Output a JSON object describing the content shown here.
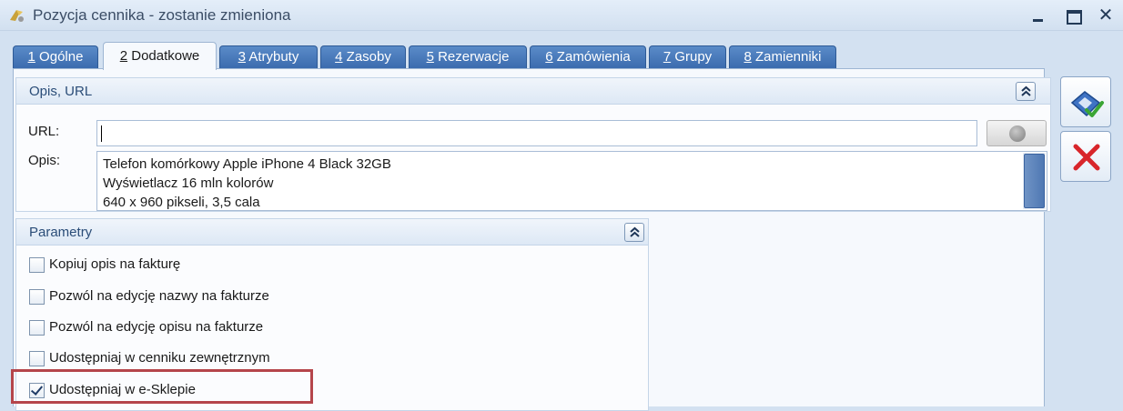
{
  "window": {
    "title": "Pozycja cennika - zostanie zmieniona",
    "close_glyph": "✕"
  },
  "tabs": [
    {
      "num": "1",
      "label": " Ogólne"
    },
    {
      "num": "2",
      "label": " Dodatkowe",
      "active": true
    },
    {
      "num": "3",
      "label": " Atrybuty"
    },
    {
      "num": "4",
      "label": " Zasoby"
    },
    {
      "num": "5",
      "label": " Rezerwacje"
    },
    {
      "num": "6",
      "label": " Zamówienia"
    },
    {
      "num": "7",
      "label": " Grupy"
    },
    {
      "num": "8",
      "label": " Zamienniki"
    }
  ],
  "opis_group": {
    "title": "Opis, URL",
    "url_label": "URL:",
    "url_value": "",
    "opis_label": "Opis:",
    "opis_lines": [
      "Telefon komórkowy Apple iPhone 4 Black 32GB",
      "Wyświetlacz 16 mln kolorów",
      "640 x 960 pikseli, 3,5 cala"
    ]
  },
  "parametry_group": {
    "title": "Parametry",
    "checkboxes": [
      {
        "label": "Kopiuj opis na fakturę",
        "checked": false
      },
      {
        "label": "Pozwól na edycję nazwy na fakturze",
        "checked": false
      },
      {
        "label": "Pozwól na edycję opisu na fakturze",
        "checked": false
      },
      {
        "label": "Udostępniaj w cenniku zewnętrznym",
        "checked": false
      },
      {
        "label": "Udostępniaj w e-Sklepie",
        "checked": true
      }
    ]
  },
  "colors": {
    "tab_blue": "#3a6aad",
    "highlight": "#b5454b",
    "save_icon_green": "#3aa535",
    "cancel_icon_red": "#d8262b"
  },
  "icons": {
    "save": "save-icon",
    "cancel": "cancel-icon",
    "collapse": "double-chevron-up-icon",
    "globe": "globe-icon"
  }
}
